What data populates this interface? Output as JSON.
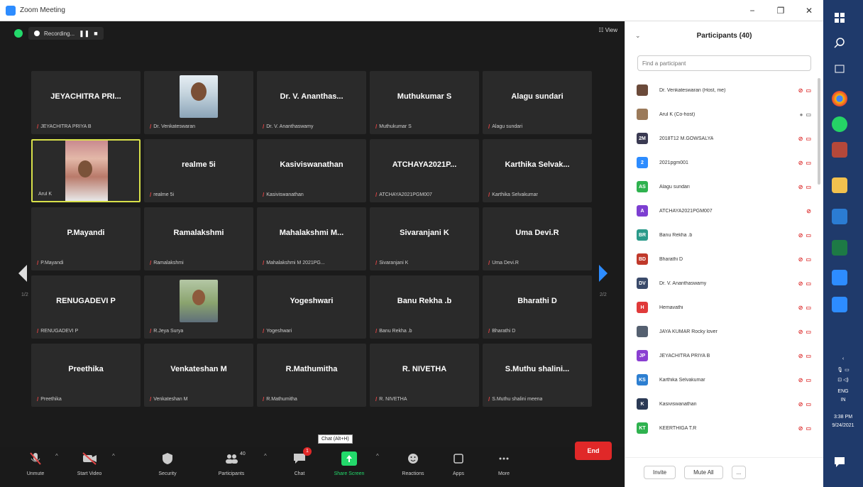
{
  "window": {
    "title": "Zoom Meeting",
    "minimize": "−",
    "restore": "❐",
    "close": "✕"
  },
  "top": {
    "recording_label": "Recording...",
    "pause_btn": "❚❚",
    "stop_btn": "■",
    "view_label": "☷ View"
  },
  "grid_tiles": [
    {
      "name": "JEYACHITRA PRI...",
      "label": "JEYACHITRA PRIYA B",
      "kind": "text"
    },
    {
      "name": "",
      "label": "Dr. Venkateswaran",
      "kind": "photo1"
    },
    {
      "name": "Dr. V. Ananthas...",
      "label": "Dr. V. Ananthaswamy",
      "kind": "text"
    },
    {
      "name": "Muthukumar S",
      "label": "Muthukumar S",
      "kind": "text"
    },
    {
      "name": "Alagu sundari",
      "label": "Alagu sundari",
      "kind": "text"
    },
    {
      "name": "",
      "label": "Arul K",
      "kind": "video"
    },
    {
      "name": "realme 5i",
      "label": "realme 5i",
      "kind": "text"
    },
    {
      "name": "Kasiviswanathan",
      "label": "Kasiviswanathan",
      "kind": "text"
    },
    {
      "name": "ATCHAYA2021P...",
      "label": "ATCHAYA2021PGM007",
      "kind": "text"
    },
    {
      "name": "Karthika Selvak...",
      "label": "Karthika Selvakumar",
      "kind": "text"
    },
    {
      "name": "P.Mayandi",
      "label": "P.Mayandi",
      "kind": "text"
    },
    {
      "name": "Ramalakshmi",
      "label": "Ramalakshmi",
      "kind": "text"
    },
    {
      "name": "Mahalakshmi M...",
      "label": "Mahalakshmi M 2021PG...",
      "kind": "text"
    },
    {
      "name": "Sivaranjani K",
      "label": "Sivaranjani K",
      "kind": "text"
    },
    {
      "name": "Uma Devi.R",
      "label": "Uma Devi.R",
      "kind": "text"
    },
    {
      "name": "RENUGADEVI P",
      "label": "RENUGADEVI P",
      "kind": "text"
    },
    {
      "name": "",
      "label": "R.Jeya Surya",
      "kind": "photo2"
    },
    {
      "name": "Yogeshwari",
      "label": "Yogeshwari",
      "kind": "text"
    },
    {
      "name": "Banu Rekha .b",
      "label": "Banu Rekha .b",
      "kind": "text"
    },
    {
      "name": "Bharathi D",
      "label": "Bharathi D",
      "kind": "text"
    },
    {
      "name": "Preethika",
      "label": "Preethika",
      "kind": "text"
    },
    {
      "name": "Venkateshan M",
      "label": "Venkateshan M",
      "kind": "text"
    },
    {
      "name": "R.Mathumitha",
      "label": "R.Mathumitha",
      "kind": "text"
    },
    {
      "name": "R. NIVETHA",
      "label": "R. NIVETHA",
      "kind": "text"
    },
    {
      "name": "S.Muthu shalini...",
      "label": "S.Muthu shalini meena",
      "kind": "text"
    }
  ],
  "pager": {
    "left": "1/2",
    "right": "2/2"
  },
  "toolbar": {
    "unmute": "Unmute",
    "start_video": "Start Video",
    "security": "Security",
    "participants": "Participants",
    "participants_count": "40",
    "chat": "Chat",
    "chat_badge": "1",
    "chat_tooltip": "Chat (Alt+H)",
    "share_screen": "Share Screen",
    "reactions": "Reactions",
    "apps": "Apps",
    "more": "More",
    "end": "End"
  },
  "panel": {
    "title": "Participants (40)",
    "search_placeholder": "Find a participant",
    "participants": [
      {
        "name": "Dr. Venkateswaran (Host, me)",
        "avatar": "",
        "color": "#6b4a3a"
      },
      {
        "name": "Arul K (Co-host)",
        "avatar": "",
        "color": "#9b7a5a"
      },
      {
        "name": "2018T12 M.GOWSALYA",
        "avatar": "2M",
        "color": "#3a3a52"
      },
      {
        "name": "2021pgm001",
        "avatar": "2",
        "color": "#2d8cff"
      },
      {
        "name": "Alagu sundari",
        "avatar": "AS",
        "color": "#2fb24f"
      },
      {
        "name": "ATCHAYA2021PGM007",
        "avatar": "A",
        "color": "#7d3fd1"
      },
      {
        "name": "Banu Rekha .b",
        "avatar": "BR",
        "color": "#2a9a8a"
      },
      {
        "name": "Bharathi D",
        "avatar": "BD",
        "color": "#c0392b"
      },
      {
        "name": "Dr. V. Ananthaswamy",
        "avatar": "DV",
        "color": "#3a4a6a"
      },
      {
        "name": "Hemavathi",
        "avatar": "H",
        "color": "#e03a3a"
      },
      {
        "name": "JAYA KUMAR Rocky lover",
        "avatar": "",
        "color": "#556070"
      },
      {
        "name": "JEYACHITRA PRIYA B",
        "avatar": "JP",
        "color": "#8a3fd1"
      },
      {
        "name": "Karthika Selvakumar",
        "avatar": "KS",
        "color": "#2d7fd1"
      },
      {
        "name": "Kasiviswanathan",
        "avatar": "K",
        "color": "#2b3a55"
      },
      {
        "name": "KEERTHIGA T.R",
        "avatar": "KT",
        "color": "#2fb24f"
      }
    ],
    "invite": "Invite",
    "mute_all": "Mute All",
    "more": "..."
  },
  "taskbar": {
    "lang": "ENG",
    "region": "IN",
    "time": "3:38 PM",
    "date": "9/24/2021"
  }
}
